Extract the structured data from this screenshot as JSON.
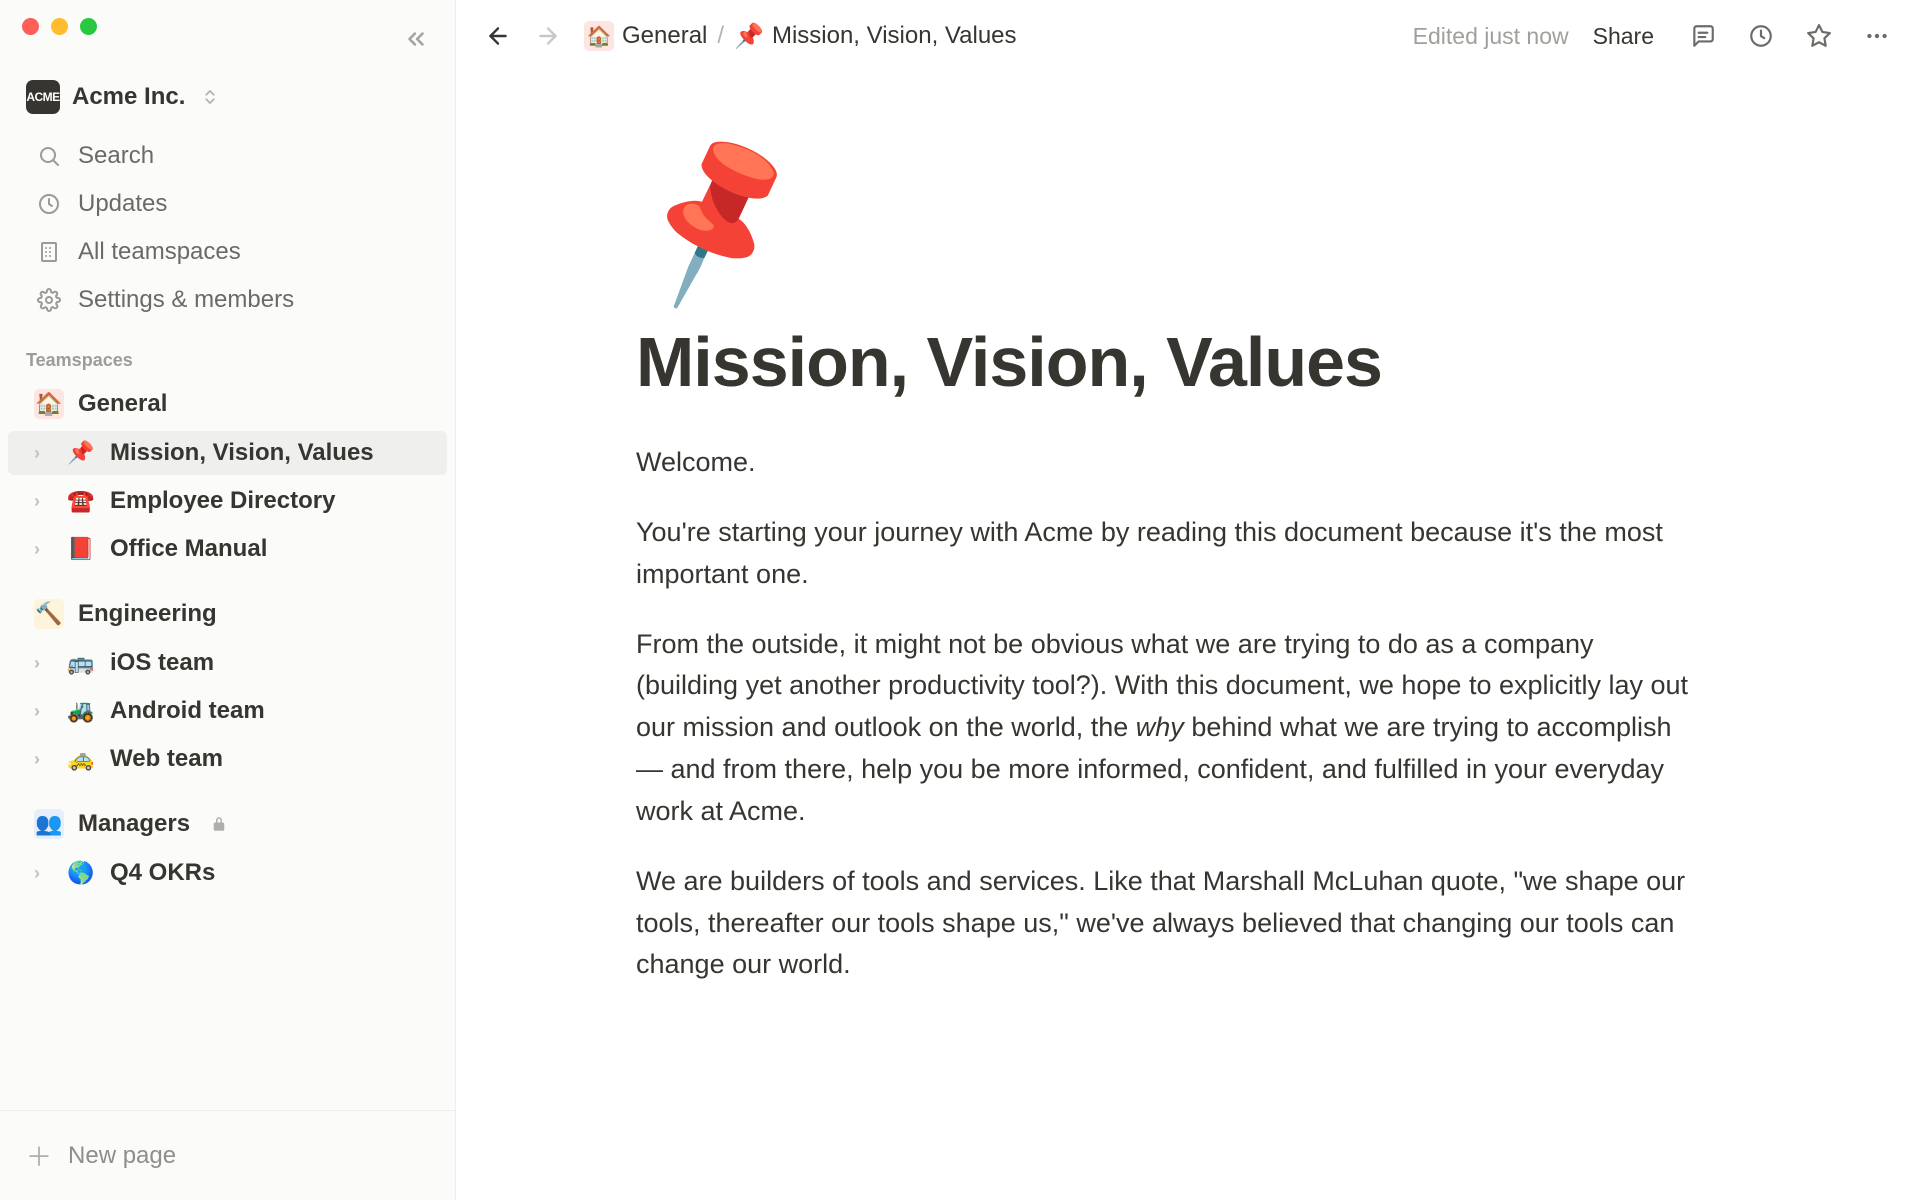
{
  "workspace": {
    "badge": "ACME",
    "name": "Acme Inc."
  },
  "sidebarTop": {
    "search": "Search",
    "updates": "Updates",
    "allTeamspaces": "All teamspaces",
    "settings": "Settings & members"
  },
  "sections": {
    "teamspacesLabel": "Teamspaces"
  },
  "teamspaces": {
    "general": {
      "icon": "🏠",
      "label": "General",
      "pages": [
        {
          "icon": "📌",
          "label": "Mission, Vision, Values",
          "active": true
        },
        {
          "icon": "☎️",
          "label": "Employee Directory",
          "active": false
        },
        {
          "icon": "📕",
          "label": "Office Manual",
          "active": false
        }
      ]
    },
    "engineering": {
      "icon": "🔨",
      "label": "Engineering",
      "pages": [
        {
          "icon": "🚌",
          "label": "iOS team"
        },
        {
          "icon": "🚜",
          "label": "Android team"
        },
        {
          "icon": "🚕",
          "label": "Web team"
        }
      ]
    },
    "managers": {
      "icon": "👥",
      "label": "Managers",
      "locked": true,
      "pages": [
        {
          "icon": "🌎",
          "label": "Q4 OKRs"
        }
      ]
    }
  },
  "newPageLabel": "New page",
  "topbar": {
    "crumb1": {
      "icon": "🏠",
      "label": "General"
    },
    "crumb2": {
      "icon": "📌",
      "label": "Mission, Vision, Values"
    },
    "editedText": "Edited just now",
    "shareLabel": "Share"
  },
  "page": {
    "heroIcon": "📌",
    "title": "Mission, Vision, Values",
    "p1": "Welcome.",
    "p2": "You're starting your journey with Acme by reading this document because it's the most important one.",
    "p3a": "From the outside, it might not be obvious what we are trying to do as a company (building yet another productivity tool?). With this document, we hope to explicitly lay out our mission and outlook on the world, the ",
    "p3em": "why",
    "p3b": " behind what we are trying to accomplish — and from there, help you be more informed, confident, and fulfilled in your everyday work at Acme.",
    "p4": "We are builders of tools and services. Like that Marshall McLuhan quote, \"we shape our tools, thereafter our tools shape us,\" we've always believed that changing our tools can change our world."
  }
}
